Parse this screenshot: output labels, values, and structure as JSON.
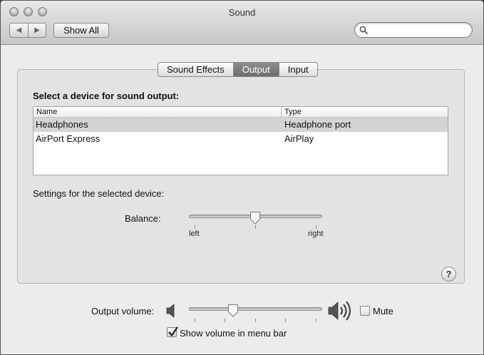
{
  "window": {
    "title": "Sound"
  },
  "toolbar": {
    "back_glyph": "◀",
    "forward_glyph": "▶",
    "show_all_label": "Show All",
    "search": {
      "value": "",
      "placeholder": ""
    }
  },
  "tabs": [
    {
      "label": "Sound Effects",
      "active": false
    },
    {
      "label": "Output",
      "active": true
    },
    {
      "label": "Input",
      "active": false
    }
  ],
  "output": {
    "heading": "Select a device for sound output:",
    "columns": [
      "Name",
      "Type"
    ],
    "devices": [
      {
        "name": "Headphones",
        "type": "Headphone port",
        "selected": true
      },
      {
        "name": "AirPort Express",
        "type": "AirPlay",
        "selected": false
      }
    ],
    "settings_label": "Settings for the selected device:",
    "balance": {
      "label": "Balance:",
      "left_label": "left",
      "right_label": "right",
      "value": 0.5
    }
  },
  "help_label": "?",
  "volume": {
    "label": "Output volume:",
    "value": 0.32,
    "mute_label": "Mute",
    "mute_checked": false,
    "show_in_menu_label": "Show volume in menu bar",
    "show_in_menu_checked": true
  },
  "icons": {
    "speaker_low": "speaker-low-icon",
    "speaker_high": "speaker-high-icon",
    "search": "search-icon"
  }
}
